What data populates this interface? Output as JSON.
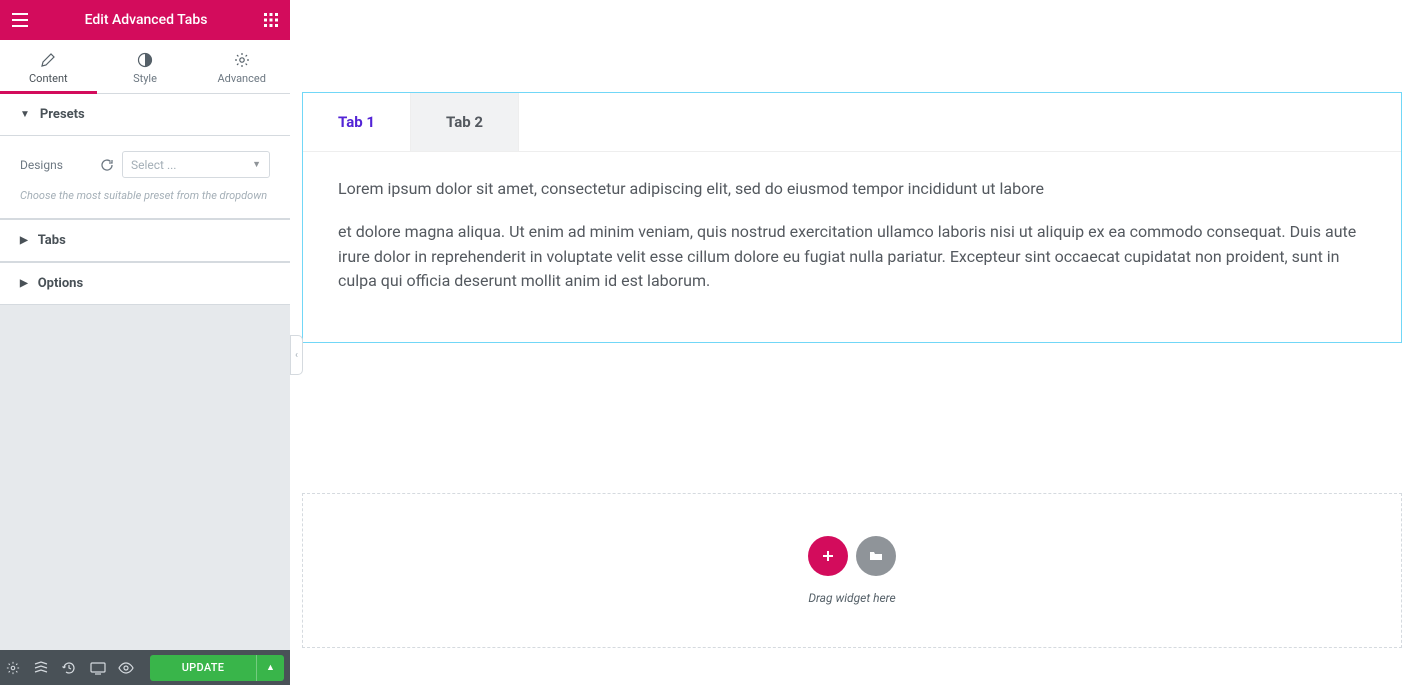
{
  "header": {
    "title": "Edit Advanced Tabs"
  },
  "panel_tabs": {
    "content": "Content",
    "style": "Style",
    "advanced": "Advanced"
  },
  "sections": {
    "presets": {
      "title": "Presets",
      "designs_label": "Designs",
      "select_placeholder": "Select ...",
      "description": "Choose the most suitable preset from the dropdown"
    },
    "tabs": {
      "title": "Tabs"
    },
    "options": {
      "title": "Options"
    }
  },
  "footer": {
    "update": "UPDATE"
  },
  "preview": {
    "tabs": [
      {
        "label": "Tab 1",
        "active": true
      },
      {
        "label": "Tab 2",
        "active": false
      }
    ],
    "content_p1": "Lorem ipsum dolor sit amet, consectetur adipiscing elit, sed do eiusmod tempor incididunt ut labore",
    "content_p2": "et dolore magna aliqua. Ut enim ad minim veniam, quis nostrud exercitation ullamco laboris nisi ut aliquip ex ea commodo consequat. Duis aute irure dolor in reprehenderit in voluptate velit esse cillum dolore eu fugiat nulla pariatur. Excepteur sint occaecat cupidatat non proident, sunt in culpa qui officia deserunt mollit anim id est laborum."
  },
  "drop": {
    "hint": "Drag widget here"
  }
}
